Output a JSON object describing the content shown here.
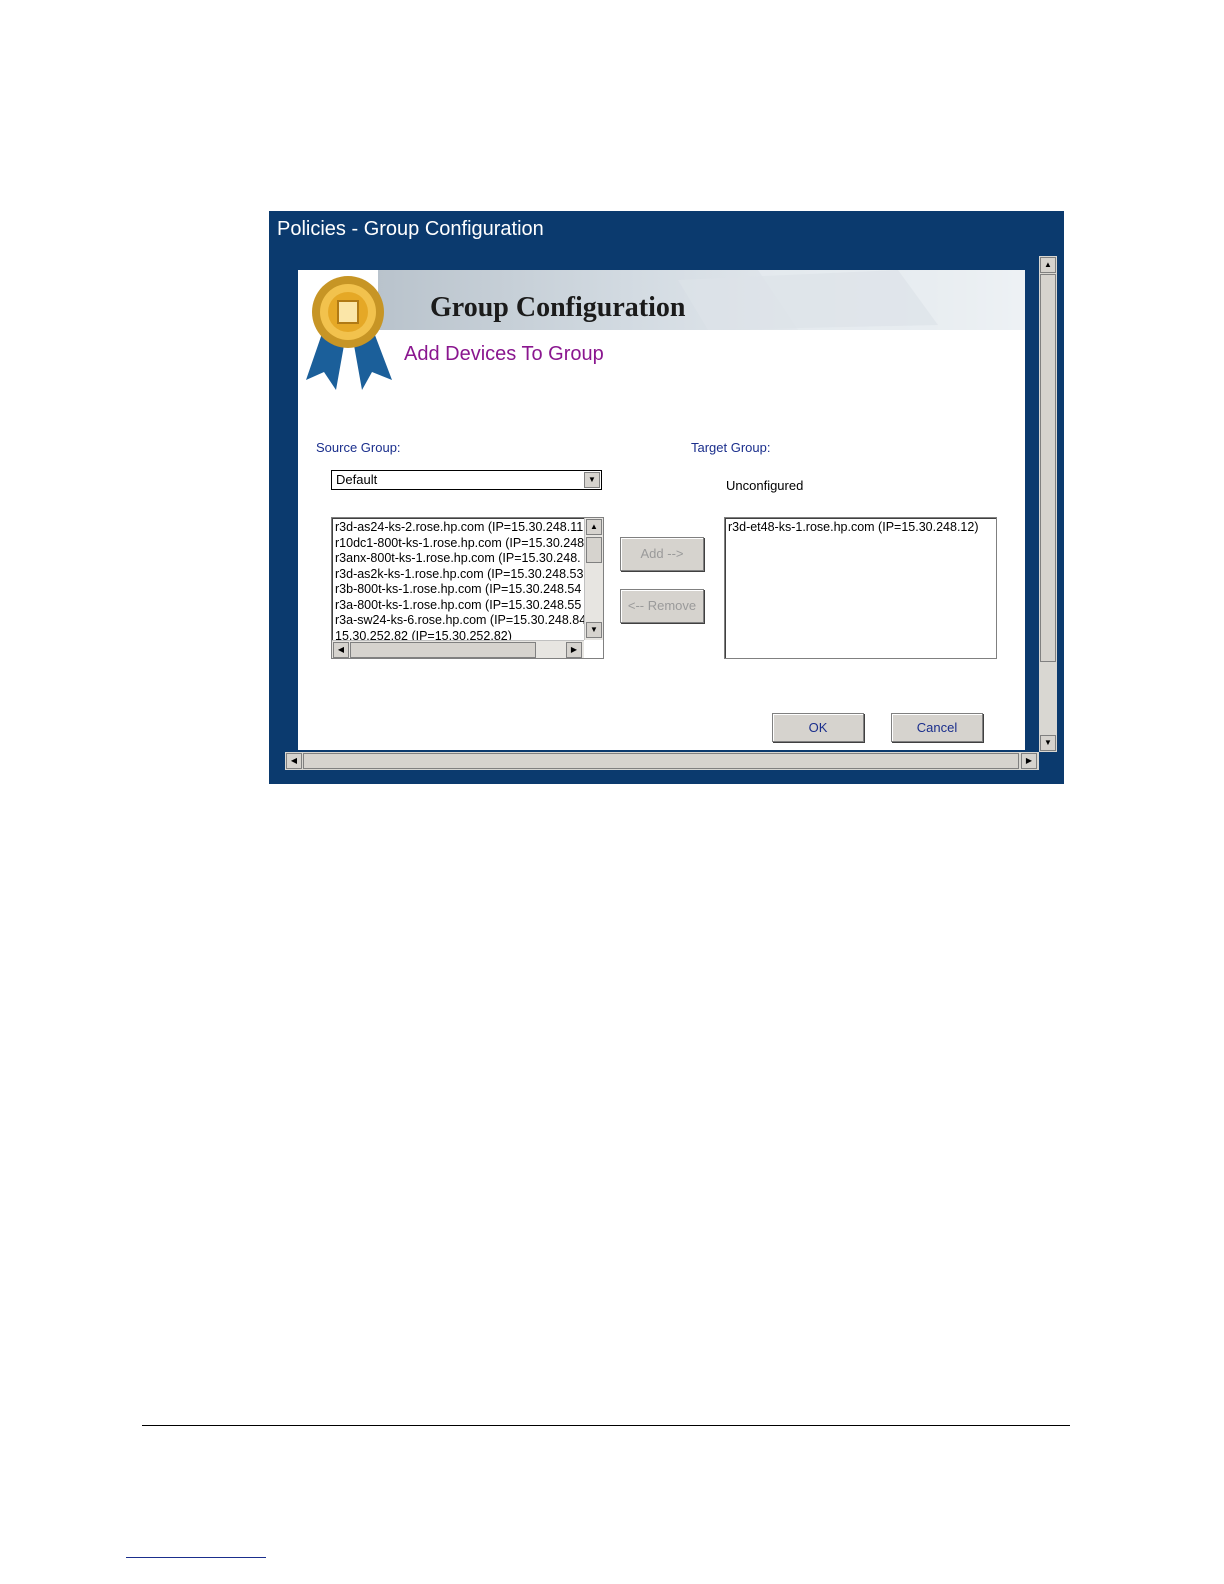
{
  "window": {
    "title": "Policies - Group Configuration"
  },
  "banner": {
    "title": "Group Configuration"
  },
  "page": {
    "subtitle": "Add Devices To Group"
  },
  "source": {
    "label": "Source Group:",
    "selected": "Default",
    "items": [
      "r3d-as24-ks-2.rose.hp.com (IP=15.30.248.11",
      "r10dc1-800t-ks-1.rose.hp.com (IP=15.30.248",
      "r3anx-800t-ks-1.rose.hp.com (IP=15.30.248.",
      "r3d-as2k-ks-1.rose.hp.com (IP=15.30.248.53",
      "r3b-800t-ks-1.rose.hp.com (IP=15.30.248.54",
      "r3a-800t-ks-1.rose.hp.com (IP=15.30.248.55",
      "r3a-sw24-ks-6.rose.hp.com (IP=15.30.248.84",
      "15.30.252.82 (IP=15.30.252.82)"
    ]
  },
  "target": {
    "label": "Target Group:",
    "group_name": "Unconfigured",
    "items": [
      "r3d-et48-ks-1.rose.hp.com (IP=15.30.248.12)"
    ]
  },
  "actions": {
    "add": "Add -->",
    "remove": "<-- Remove",
    "ok": "OK",
    "cancel": "Cancel"
  },
  "icons": {
    "ribbon": "award-ribbon-icon"
  },
  "colors": {
    "title_bar": "#0b3a6e",
    "subtitle": "#8a168f",
    "label": "#1a2e8c"
  }
}
